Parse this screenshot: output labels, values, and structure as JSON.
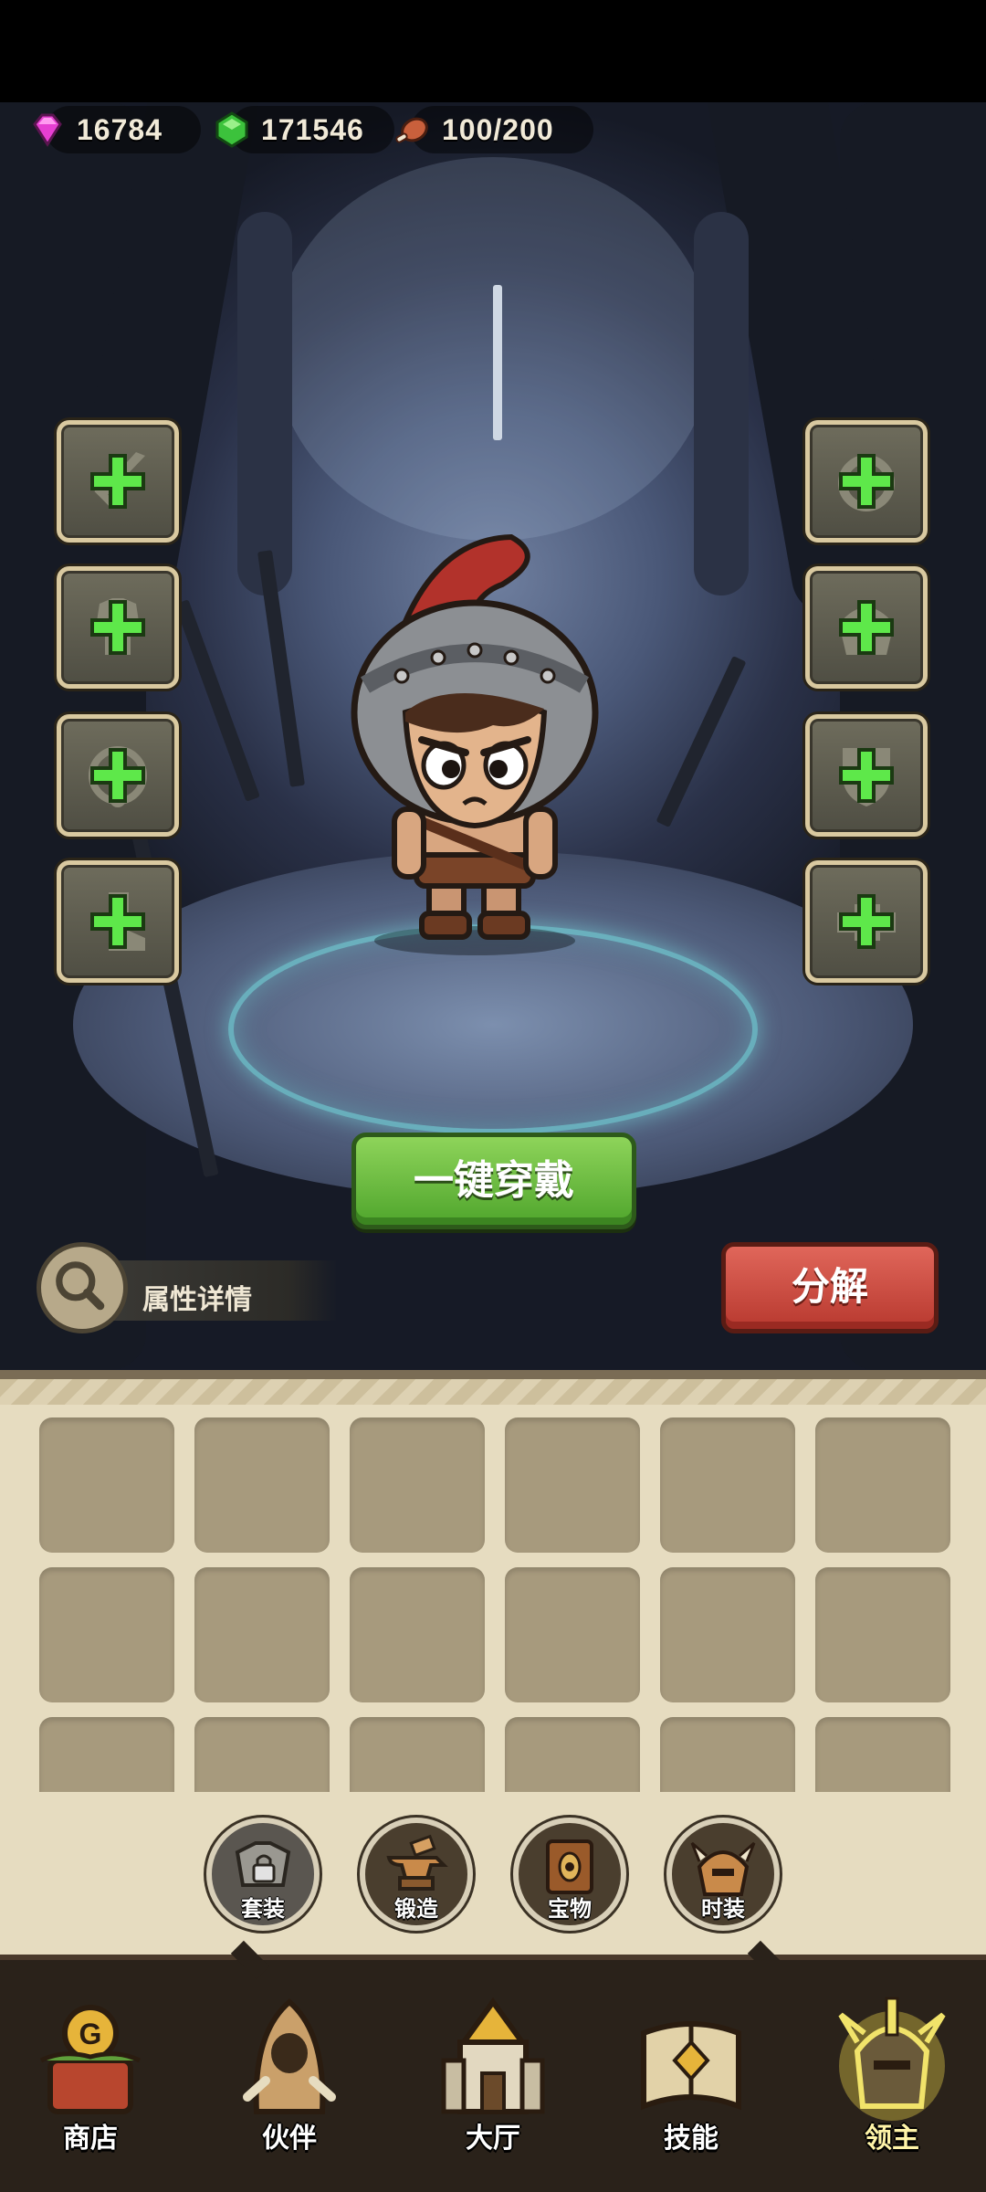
{
  "currency": {
    "gems": "16784",
    "emeralds": "171546",
    "stamina": "100/200",
    "icons": [
      "pink-gem-icon",
      "green-emerald-icon",
      "meat-icon"
    ]
  },
  "equipment_slots": {
    "left": [
      "sword-slot",
      "chest-slot",
      "necklace-slot",
      "boots-slot"
    ],
    "right": [
      "ring-slot",
      "helmet-slot",
      "shield-slot",
      "belt-slot"
    ],
    "empty_marker": "plus-icon"
  },
  "actions": {
    "equip_all": "一键穿戴",
    "attribute_details": "属性详情",
    "decompose": "分解"
  },
  "inventory": {
    "columns": 6,
    "visible_rows": 3,
    "items": []
  },
  "sub_buttons": [
    {
      "label": "套装",
      "icon": "locked-armor-set-icon",
      "locked": true
    },
    {
      "label": "锻造",
      "icon": "anvil-icon",
      "locked": false
    },
    {
      "label": "宝物",
      "icon": "treasure-book-icon",
      "locked": false
    },
    {
      "label": "时装",
      "icon": "costume-helmet-icon",
      "locked": false
    }
  ],
  "nav": {
    "active": "领主",
    "tabs": [
      {
        "label": "商店",
        "icon": "shop-icon"
      },
      {
        "label": "伙伴",
        "icon": "partner-icon"
      },
      {
        "label": "大厅",
        "icon": "hall-icon"
      },
      {
        "label": "技能",
        "icon": "skill-book-icon"
      },
      {
        "label": "领主",
        "icon": "lord-icon"
      }
    ]
  },
  "colors": {
    "equip_button": "#5fb535",
    "decompose_button": "#c9473b",
    "plus_green": "#5ee84a",
    "panel_bg": "#e6dcc0",
    "nav_bg": "#2a221a"
  }
}
